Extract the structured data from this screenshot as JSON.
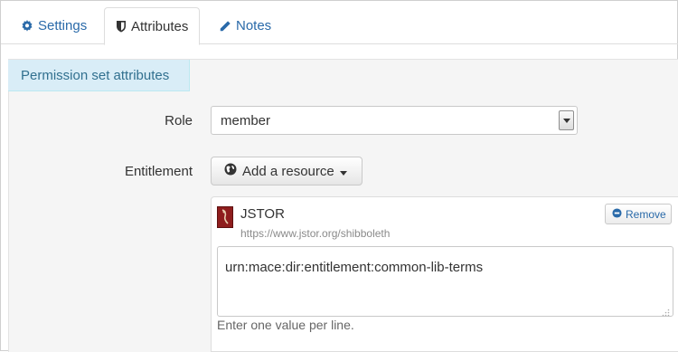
{
  "tabs": [
    {
      "label": "Settings",
      "icon": "gear-icon",
      "active": false
    },
    {
      "label": "Attributes",
      "icon": "shield-icon",
      "active": true
    },
    {
      "label": "Notes",
      "icon": "pencil-icon",
      "active": false
    }
  ],
  "panel": {
    "legend": "Permission set attributes"
  },
  "form": {
    "role_label": "Role",
    "role_value": "member",
    "entitlement_label": "Entitlement",
    "add_resource_label": "Add a resource",
    "resource": {
      "name": "JSTOR",
      "url": "https://www.jstor.org/shibboleth",
      "remove_label": "Remove",
      "value": "urn:mace:dir:entitlement:common-lib-terms",
      "help": "Enter one value per line."
    }
  },
  "colors": {
    "link": "#2a6aa9",
    "legend_bg": "#d9edf7",
    "legend_text": "#31708f",
    "panel_bg": "#f5f5f5"
  }
}
